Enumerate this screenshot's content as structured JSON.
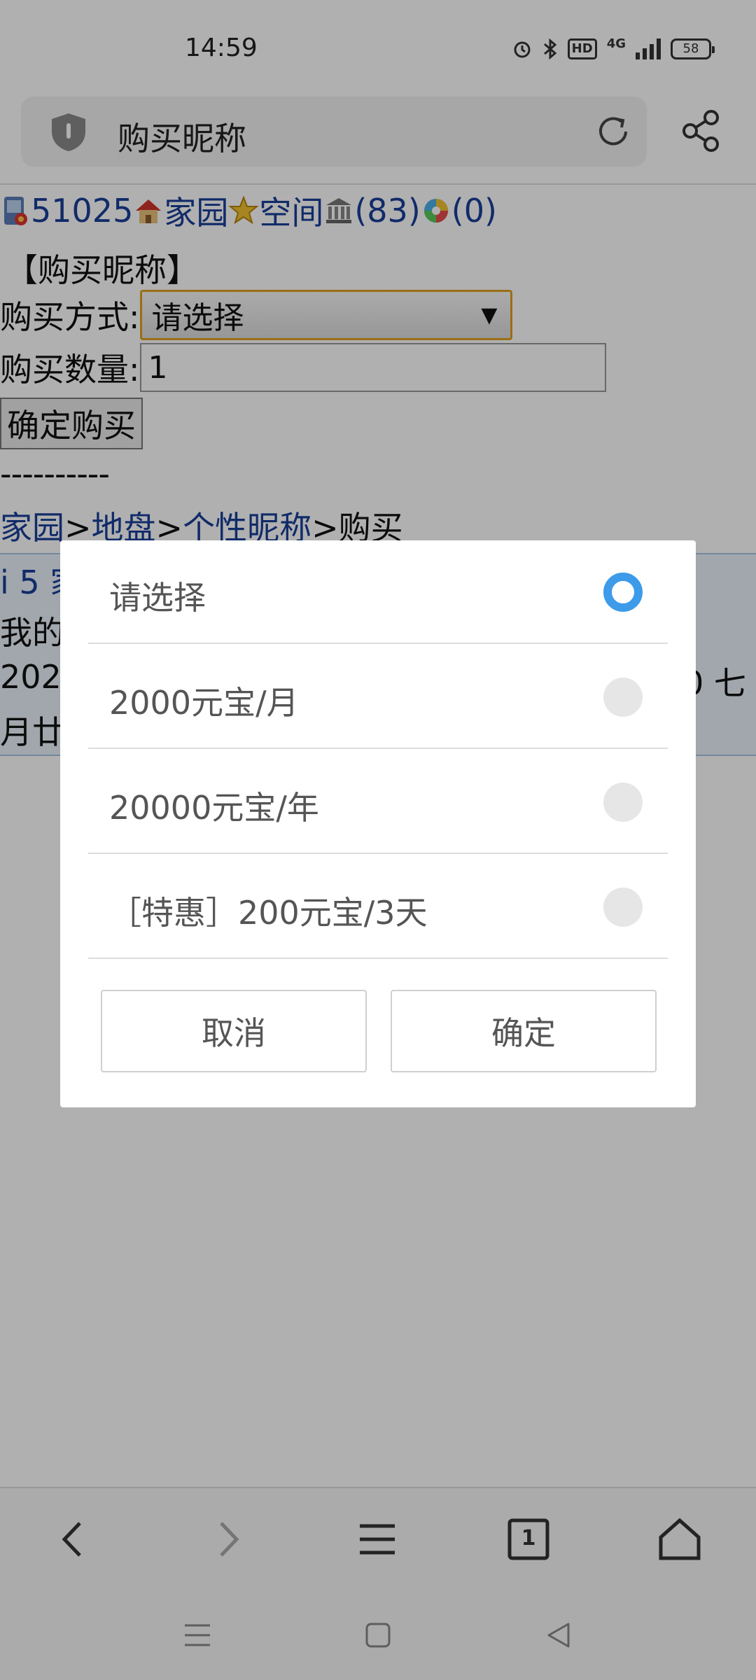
{
  "status_bar": {
    "time": "14:59",
    "hd_label": "HD",
    "network_label": "4G",
    "battery": "58"
  },
  "address_bar": {
    "title": "购买昵称"
  },
  "page": {
    "nav": {
      "user_id": "51025",
      "home_link": "家园",
      "space_link": "空间",
      "count_a": "(83)",
      "count_b": "(0)"
    },
    "section_title": "【购买昵称】",
    "purchase_method_label": "购买方式:",
    "purchase_method_value": "请选择",
    "select_arrow": "▼",
    "quantity_label": "购买数量:",
    "quantity_value": "1",
    "confirm_buy_button": "确定购买",
    "separator": "----------",
    "breadcrumb": {
      "home": "家园",
      "sep1": ">",
      "land": "地盘",
      "sep2": ">",
      "nickname": "个性昵称",
      "sep3": ">",
      "current": "购买"
    },
    "info": {
      "line1": "i 5 家",
      "line2": "我的",
      "line3": "202",
      "line3_right": "0 七",
      "line4": "月廿"
    }
  },
  "dialog": {
    "options": [
      {
        "label": "请选择",
        "checked": true
      },
      {
        "label": "2000元宝/月",
        "checked": false
      },
      {
        "label": "20000元宝/年",
        "checked": false
      },
      {
        "label": "［特惠］200元宝/3天",
        "checked": false
      }
    ],
    "cancel_label": "取消",
    "ok_label": "确定"
  },
  "browser_bar": {
    "tab_count": "1"
  },
  "colors": {
    "accent": "#3d9be9",
    "link": "#1a3f99",
    "select_border": "#e0a020",
    "overlay": "rgba(0,0,0,0.31)"
  }
}
